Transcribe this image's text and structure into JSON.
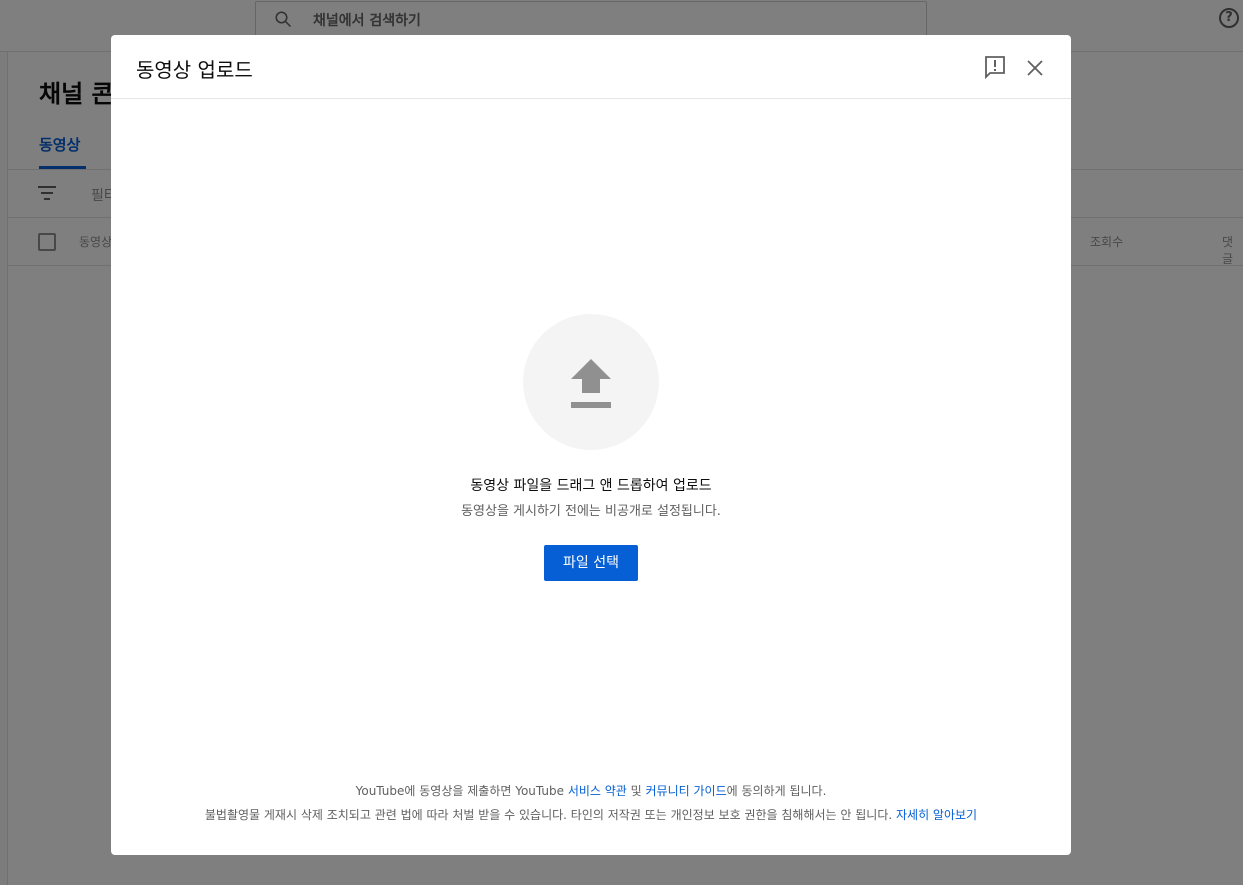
{
  "background": {
    "search": {
      "placeholder": "채널에서 검색하기"
    },
    "help_icon_glyph": "?",
    "page_title": "채널 콘",
    "tabs": [
      {
        "label": "동영상",
        "active": true
      }
    ],
    "filter_text": "필터",
    "table_headers": {
      "video": "동영상",
      "views": "조회수",
      "comments": "댓글"
    }
  },
  "dialog": {
    "title": "동영상 업로드",
    "icons": {
      "feedback": "feedback-icon",
      "close": "close-icon",
      "upload": "upload-arrow-icon"
    },
    "drop_title": "동영상 파일을 드래그 앤 드롭하여 업로드",
    "drop_subtitle": "동영상을 게시하기 전에는 비공개로 설정됩니다.",
    "select_button_label": "파일 선택",
    "footer": {
      "line1_prefix": "YouTube에 동영상을 제출하면 YouTube ",
      "terms_link": "서비스 약관",
      "line1_and": " 및 ",
      "guidelines_link": "커뮤니티 가이드",
      "line1_suffix": "에 동의하게 됩니다.",
      "line2_text": "불법촬영물 게재시 삭제 조치되고 관련 법에 따라 처벌 받을 수 있습니다. 타인의 저작권 또는 개인정보 보호 권한을 침해해서는 안 됩니다. ",
      "learn_more_link": "자세히 알아보기"
    }
  },
  "colors": {
    "accent": "#065fd4",
    "scrim": "rgba(0,0,0,0.5)",
    "upload_circle": "#f4f4f4",
    "upload_icon": "#909090"
  }
}
